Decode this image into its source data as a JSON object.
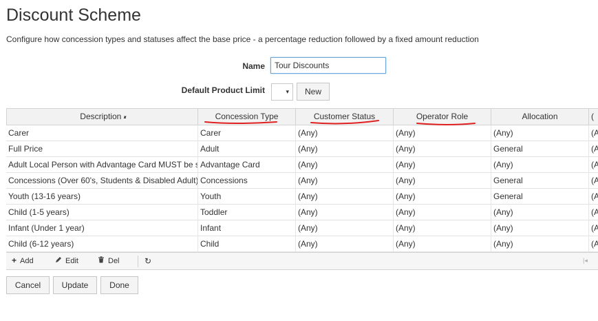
{
  "page": {
    "title": "Discount Scheme",
    "subtitle": "Configure how concession types and statuses affect the base price - a percentage reduction followed by a fixed amount reduction"
  },
  "form": {
    "name_label": "Name",
    "name_value": "Tour Discounts",
    "limit_label": "Default Product Limit",
    "limit_value": "▾",
    "new_label": "New"
  },
  "grid": {
    "headers": [
      "Description",
      "Concession Type",
      "Customer Status",
      "Operator Role",
      "Allocation",
      "("
    ],
    "sort_icon": "▴▾",
    "rows": [
      [
        "Carer",
        "Carer",
        "(Any)",
        "(Any)",
        "(Any)",
        "(A"
      ],
      [
        "Full Price",
        "Adult",
        "(Any)",
        "(Any)",
        "General",
        "(A"
      ],
      [
        "Adult Local Person with Advantage Card MUST be s",
        "Advantage Card",
        "(Any)",
        "(Any)",
        "(Any)",
        "(A"
      ],
      [
        "Concessions (Over 60's, Students & Disabled Adult)",
        "Concessions",
        "(Any)",
        "(Any)",
        "General",
        "(A"
      ],
      [
        "Youth (13-16 years)",
        "Youth",
        "(Any)",
        "(Any)",
        "General",
        "(A"
      ],
      [
        "Child (1-5 years)",
        "Toddler",
        "(Any)",
        "(Any)",
        "(Any)",
        "(A"
      ],
      [
        "Infant (Under 1 year)",
        "Infant",
        "(Any)",
        "(Any)",
        "(Any)",
        "(A"
      ],
      [
        "Child (6-12 years)",
        "Child",
        "(Any)",
        "(Any)",
        "(Any)",
        "(A"
      ]
    ]
  },
  "toolbar": {
    "add_label": "Add",
    "edit_label": "Edit",
    "del_label": "Del",
    "add_icon": "plus-icon",
    "edit_icon": "pencil-icon",
    "del_icon": "trash-icon",
    "refresh_icon": "refresh-icon",
    "first_page_icon": "first-page-icon"
  },
  "footer": {
    "cancel_label": "Cancel",
    "update_label": "Update",
    "done_label": "Done"
  },
  "colors": {
    "annotation_underline": "#e02020",
    "input_focus_border": "#6fa6d9"
  }
}
